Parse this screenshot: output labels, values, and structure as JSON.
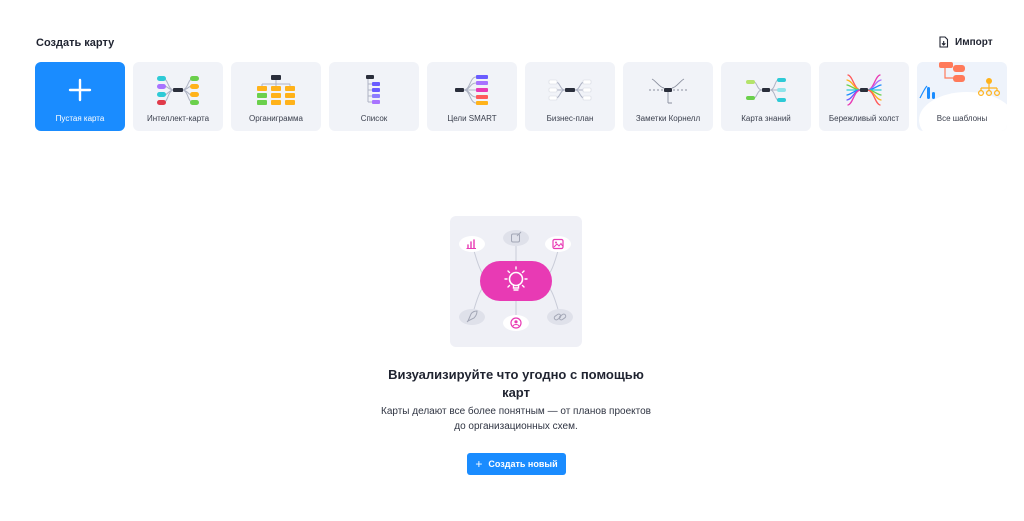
{
  "header": {
    "title": "Создать карту",
    "import_label": "Импорт"
  },
  "templates": [
    {
      "label": "Пустая карта",
      "icon": "plus-icon"
    },
    {
      "label": "Интеллект-карта",
      "icon": "mind-map-icon"
    },
    {
      "label": "Органиграмма",
      "icon": "org-chart-icon"
    },
    {
      "label": "Список",
      "icon": "list-icon"
    },
    {
      "label": "Цели SMART",
      "icon": "smart-goals-icon"
    },
    {
      "label": "Бизнес-план",
      "icon": "business-plan-icon"
    },
    {
      "label": "Заметки Корнелл",
      "icon": "cornell-notes-icon"
    },
    {
      "label": "Карта знаний",
      "icon": "knowledge-map-icon"
    },
    {
      "label": "Бережливый холст",
      "icon": "lean-canvas-icon"
    },
    {
      "label": "Все шаблоны",
      "icon": "all-templates-icon"
    }
  ],
  "empty_state": {
    "title": "Визуализируйте что угодно с помощью карт",
    "description": "Карты делают все более понятным — от планов проектов до организационных схем.",
    "button_label": "Создать новый"
  },
  "colors": {
    "accent": "#1a8cff",
    "illustration_pink": "#e83ab4",
    "card_bg": "#f1f3f8"
  }
}
